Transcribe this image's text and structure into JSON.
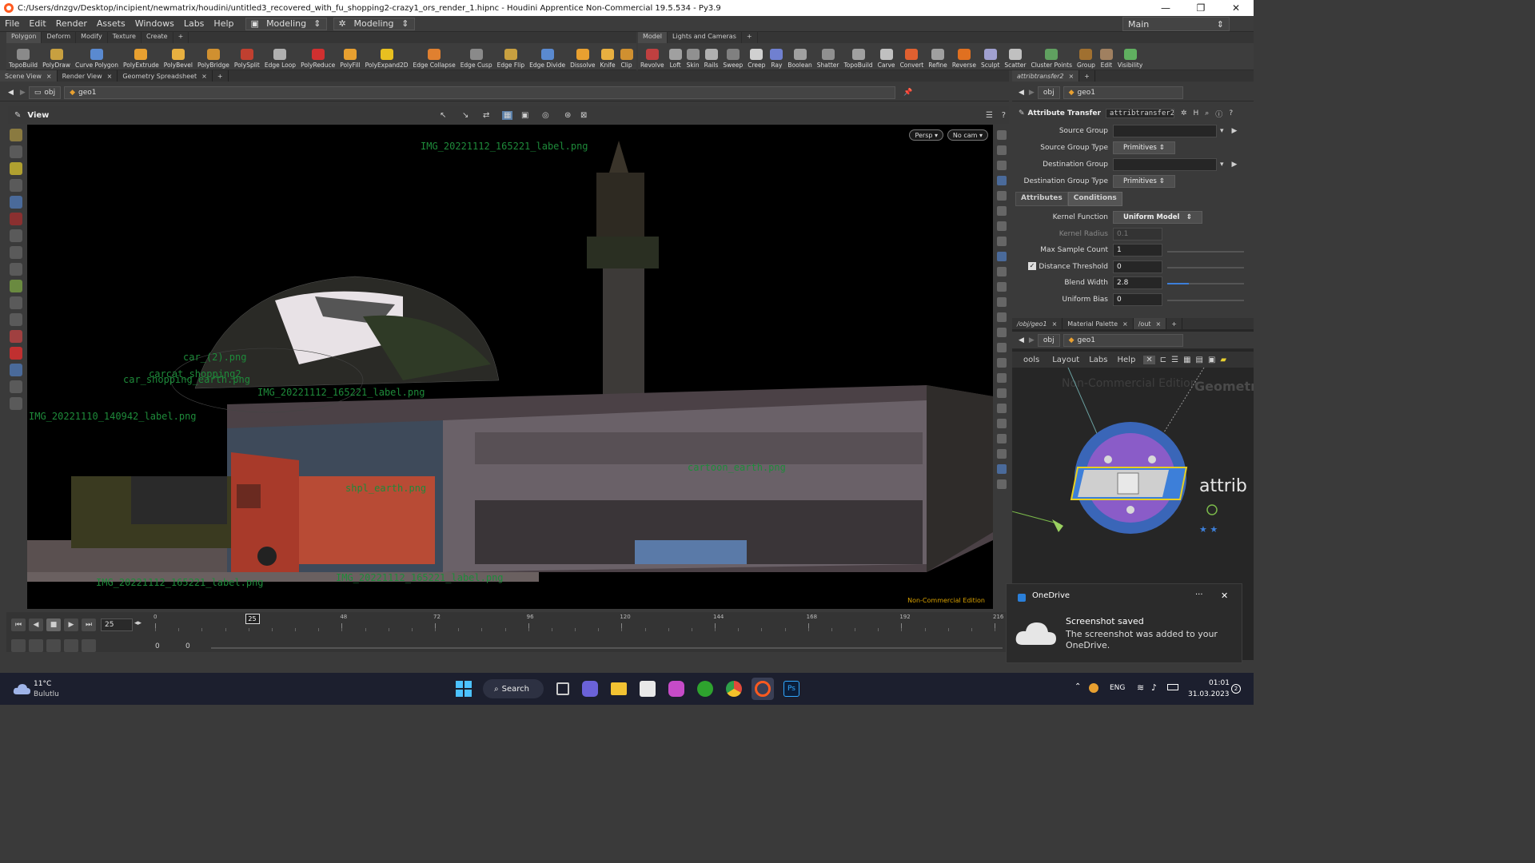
{
  "window": {
    "title": "C:/Users/dnzgv/Desktop/incipient/newmatrix/houdini/untitled3_recovered_with_fu_shopping2-crazy1_ors_render_1.hipnc - Houdini Apprentice Non-Commercial 19.5.534 - Py3.9"
  },
  "menubar": {
    "items": [
      "File",
      "Edit",
      "Render",
      "Assets",
      "Windows",
      "Labs",
      "Help"
    ],
    "desktop1": "Modeling",
    "desktop2": "Modeling",
    "main_desktop": "Main"
  },
  "shelf_left": {
    "tabs": [
      "Polygon",
      "Deform",
      "Modify",
      "Texture",
      "Create"
    ],
    "tools": [
      "TopoBuild",
      "PolyDraw",
      "Curve Polygon",
      "PolyExtrude",
      "PolyBevel",
      "PolyBridge",
      "PolySplit",
      "Edge Loop",
      "PolyReduce",
      "PolyFill",
      "PolyExpand2D",
      "Edge Collapse",
      "Edge Cusp",
      "Edge Flip",
      "Edge Divide",
      "Dissolve",
      "Knife",
      "Clip"
    ]
  },
  "shelf_right": {
    "tabs": [
      "Model",
      "Lights and Cameras"
    ],
    "tools": [
      "Revolve",
      "Loft",
      "Skin",
      "Rails",
      "Sweep",
      "Creep",
      "Ray",
      "Boolean",
      "Shatter",
      "TopoBuild",
      "Carve",
      "Convert",
      "Refine",
      "Reverse",
      "Sculpt",
      "Scatter",
      "Cluster Points",
      "Group",
      "Edit",
      "Visibility"
    ]
  },
  "left_pane": {
    "tabs": [
      "Scene View",
      "Render View",
      "Geometry Spreadsheet"
    ],
    "path": [
      "obj",
      "geo1"
    ],
    "view_label": "View",
    "persp": "Persp",
    "cam": "No cam",
    "non_commercial": "Non-Commercial Edition",
    "labels": [
      "IMG_20221112_165221_label.png",
      "car_(2).png",
      "carcat_shopping2",
      "car_shopping_earth.png",
      "IMG_20221112_165221_label.png",
      "IMG_20221110_140942_label.png",
      "shpl_earth.png",
      "cartoon_earth.png",
      "IMG_20221112_165221_label.png",
      "IMG_20221112_165221_label.png"
    ]
  },
  "timeline": {
    "frame": "25",
    "current": "25",
    "ticks": [
      "0",
      "48",
      "72",
      "96",
      "120",
      "144",
      "168",
      "192",
      "216"
    ],
    "start": "0",
    "end": "0"
  },
  "parm_pane": {
    "tab": "attribtransfer2",
    "path": [
      "obj",
      "geo1"
    ],
    "node_type": "Attribute Transfer",
    "node_name": "attribtransfer2",
    "source_group_label": "Source Group",
    "source_group_type_label": "Source Group Type",
    "source_group_type": "Primitives",
    "dest_group_label": "Destination Group",
    "dest_group_type_label": "Destination Group Type",
    "dest_group_type": "Primitives",
    "subtabs": [
      "Attributes",
      "Conditions"
    ],
    "kernel_function_label": "Kernel Function",
    "kernel_function": "Uniform Model",
    "kernel_radius_label": "Kernel Radius",
    "kernel_radius": "0.1",
    "max_sample_label": "Max Sample Count",
    "max_sample": "1",
    "dist_threshold_label": "Distance Threshold",
    "dist_threshold": "0",
    "blend_width_label": "Blend Width",
    "blend_width": "2.8",
    "uniform_bias_label": "Uniform Bias",
    "uniform_bias": "0"
  },
  "net_pane": {
    "tabs": [
      "/obj/geo1",
      "Material Palette",
      "/out"
    ],
    "path": [
      "obj",
      "geo1"
    ],
    "menu": [
      "ools",
      "Layout",
      "Labs",
      "Help"
    ],
    "watermark": "Non-Commercial Edition",
    "context": "Geometry",
    "node_label": "attrib"
  },
  "toast": {
    "app": "OneDrive",
    "title": "Screenshot saved",
    "body": "The screenshot was added to your OneDrive."
  },
  "taskbar": {
    "temp": "11°C",
    "weather": "Bulutlu",
    "search": "Search",
    "lang": "ENG",
    "time": "01:01",
    "date": "31.03.2023",
    "notif_count": "2"
  },
  "colors": {
    "accent_blue": "#3d7fd9",
    "node_purple": "#8a5cc8",
    "node_ring": "#3a66b8",
    "label_green": "#1e8a3a",
    "nce_orange": "#d8a000"
  }
}
